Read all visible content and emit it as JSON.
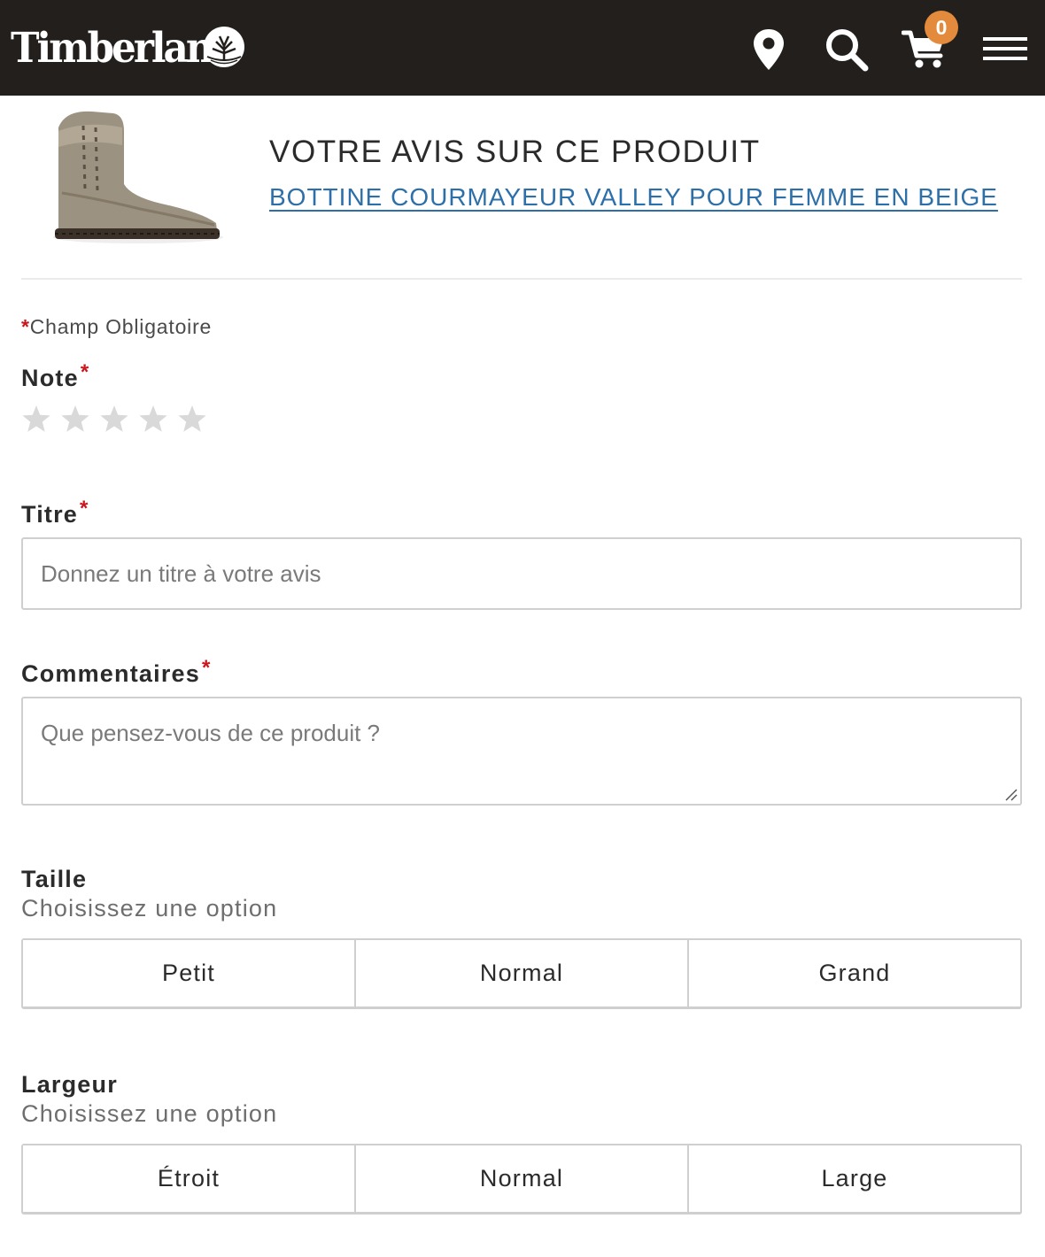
{
  "header": {
    "brand": "Timberland",
    "cart_count": "0",
    "icons": [
      "store-locator-pin-icon",
      "search-icon",
      "cart-icon",
      "menu-icon"
    ],
    "colors": {
      "bar": "#231f1c",
      "badge": "#e48a3c"
    }
  },
  "product": {
    "heading": "VOTRE AVIS SUR CE PRODUIT",
    "name": "BOTTINE COURMAYEUR VALLEY POUR FEMME EN BEIGE"
  },
  "form": {
    "required_star": "*",
    "required_note": "Champ Obligatoire",
    "rating": {
      "label": "Note",
      "max": 5,
      "value": 0
    },
    "title": {
      "label": "Titre",
      "placeholder": "Donnez un titre à votre avis",
      "value": ""
    },
    "comments": {
      "label": "Commentaires",
      "placeholder": "Que pensez-vous de ce produit ?",
      "value": ""
    },
    "size": {
      "label": "Taille",
      "hint": "Choisissez une option",
      "options": [
        "Petit",
        "Normal",
        "Grand"
      ]
    },
    "width": {
      "label": "Largeur",
      "hint": "Choisissez une option",
      "options": [
        "Étroit",
        "Normal",
        "Large"
      ]
    },
    "colors": {
      "required": "#c8181e",
      "link": "#2d6fa8",
      "star_empty": "#d9d9d9"
    }
  }
}
